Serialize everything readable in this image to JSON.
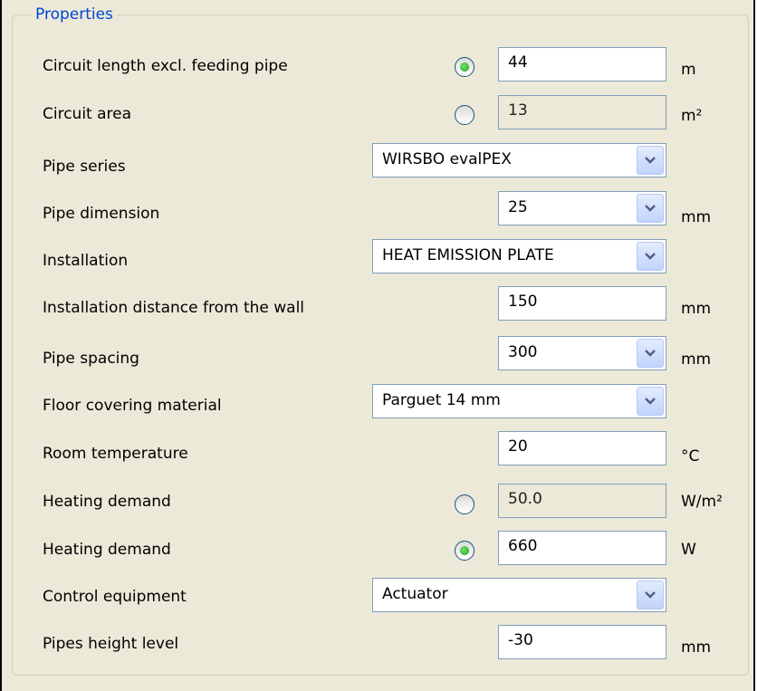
{
  "group_title": "Properties",
  "fields": {
    "circuit_length": {
      "label": "Circuit length excl. feeding pipe",
      "value": "44",
      "unit": "m",
      "radio_selected": true
    },
    "circuit_area": {
      "label": "Circuit area",
      "value": "13",
      "unit": "m²",
      "radio_selected": false
    },
    "pipe_series": {
      "label": "Pipe series",
      "value": "WIRSBO evalPEX"
    },
    "pipe_dimension": {
      "label": "Pipe dimension",
      "value": "25",
      "unit": "mm"
    },
    "installation": {
      "label": "Installation",
      "value": "HEAT EMISSION PLATE"
    },
    "installation_distance": {
      "label": "Installation distance from the wall",
      "value": "150",
      "unit": "mm"
    },
    "pipe_spacing": {
      "label": "Pipe spacing",
      "value": "300",
      "unit": "mm"
    },
    "floor_covering": {
      "label": "Floor covering material",
      "value": "Parguet 14 mm"
    },
    "room_temperature": {
      "label": "Room temperature",
      "value": "20",
      "unit": "°C"
    },
    "heating_demand_area": {
      "label": "Heating demand",
      "value": "50.0",
      "unit": "W/m²",
      "radio_selected": false
    },
    "heating_demand_total": {
      "label": "Heating demand",
      "value": "660",
      "unit": "W",
      "radio_selected": true
    },
    "control_equipment": {
      "label": "Control equipment",
      "value": "Actuator"
    },
    "pipes_height_level": {
      "label": "Pipes height level",
      "value": "-30",
      "unit": "mm"
    }
  },
  "colors": {
    "panel_background": "#ece9d8",
    "group_title": "#0046d5",
    "radio_dot": "#21a121",
    "field_border": "#7f9db9"
  }
}
